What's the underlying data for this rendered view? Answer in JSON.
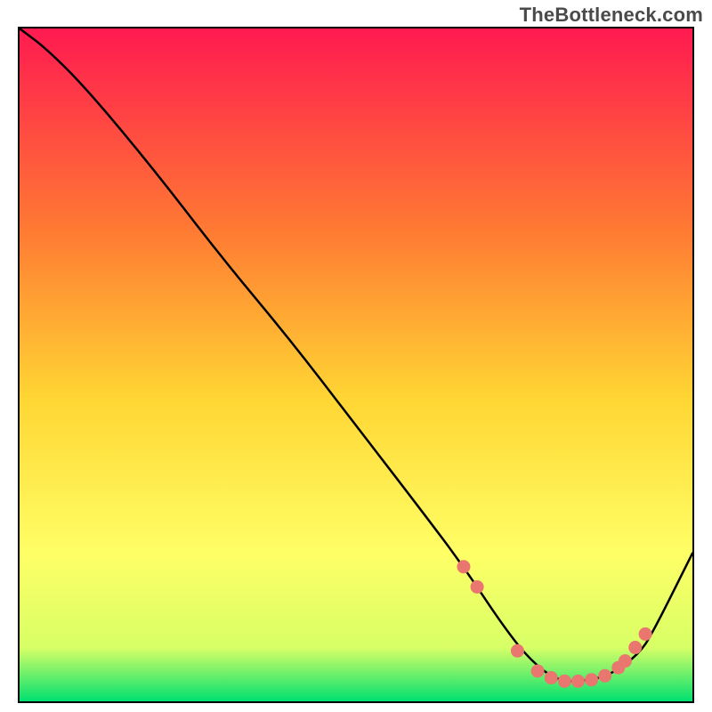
{
  "watermark": "TheBottleneck.com",
  "chart_data": {
    "type": "line",
    "title": "",
    "xlabel": "",
    "ylabel": "",
    "xlim": [
      0,
      100
    ],
    "ylim": [
      0,
      100
    ],
    "background_gradient": {
      "top": "#ff1a50",
      "upper_mid": "#ff7a33",
      "mid": "#ffd633",
      "lower_mid": "#ffff66",
      "near_bottom": "#d8ff66",
      "bottom": "#00e070"
    },
    "series": [
      {
        "name": "bottleneck-curve",
        "x": [
          0,
          4,
          10,
          20,
          30,
          40,
          50,
          60,
          66,
          72,
          76,
          80,
          84,
          88,
          92,
          94,
          100
        ],
        "y": [
          100,
          97,
          91,
          79,
          66,
          54,
          41,
          28,
          20,
          11,
          6,
          3,
          3,
          4,
          7,
          10,
          22
        ]
      }
    ],
    "markers": {
      "name": "highlight-dots",
      "x": [
        66,
        68,
        74,
        77,
        79,
        81,
        83,
        85,
        87,
        89,
        90,
        91.5,
        93
      ],
      "y": [
        20,
        17,
        7.5,
        4.5,
        3.5,
        3,
        3,
        3.2,
        3.8,
        5,
        6,
        8,
        10
      ]
    }
  }
}
